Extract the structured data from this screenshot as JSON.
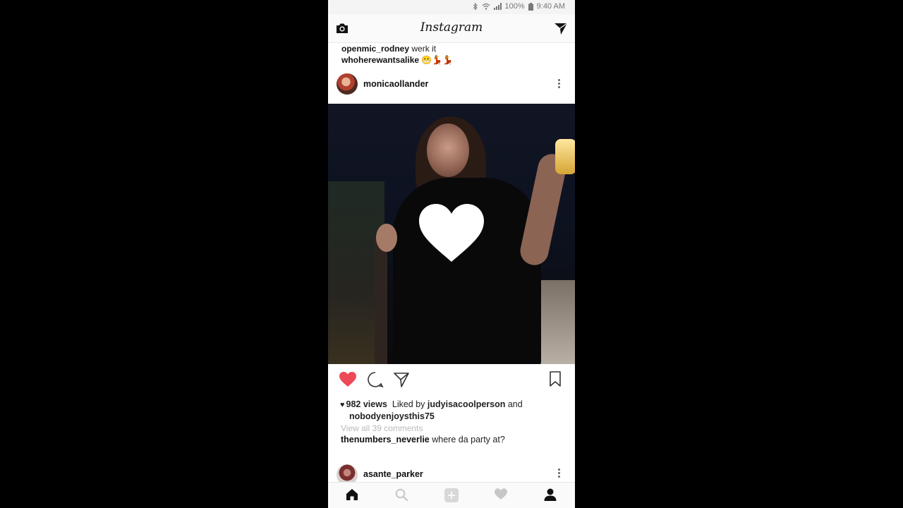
{
  "status_bar": {
    "battery": "100%",
    "time": "9:40 AM",
    "icons": [
      "bluetooth-icon",
      "wifi-icon",
      "signal-icon",
      "battery-icon"
    ]
  },
  "header": {
    "logo_text": "Instagram",
    "left_icon": "camera-icon",
    "right_icon": "direct-message-icon"
  },
  "prev_post_comments": [
    {
      "user": "openmic_rodney",
      "text": "werk it"
    },
    {
      "user": "whoherewantsalike",
      "text": "😬💃💃"
    }
  ],
  "post": {
    "username": "monicaollander",
    "liked": true,
    "views": "982 views",
    "liked_by_prefix": "Liked by",
    "liked_by_user1": "judyisacoolperson",
    "liked_by_and": "and",
    "liked_by_user2": "nobodyenjoysthis75",
    "view_comments": "View all 39 comments",
    "comment": {
      "user": "thenumbers_neverlie",
      "text": "where da party at?"
    }
  },
  "next_post": {
    "username": "asante_parker"
  },
  "bottom_nav": {
    "items": [
      "home-icon",
      "search-icon",
      "add-post-icon",
      "activity-heart-icon",
      "profile-icon"
    ],
    "active": "home-icon"
  },
  "colors": {
    "like_red": "#ed4956",
    "text": "#222222",
    "muted": "#b9b9b9"
  }
}
